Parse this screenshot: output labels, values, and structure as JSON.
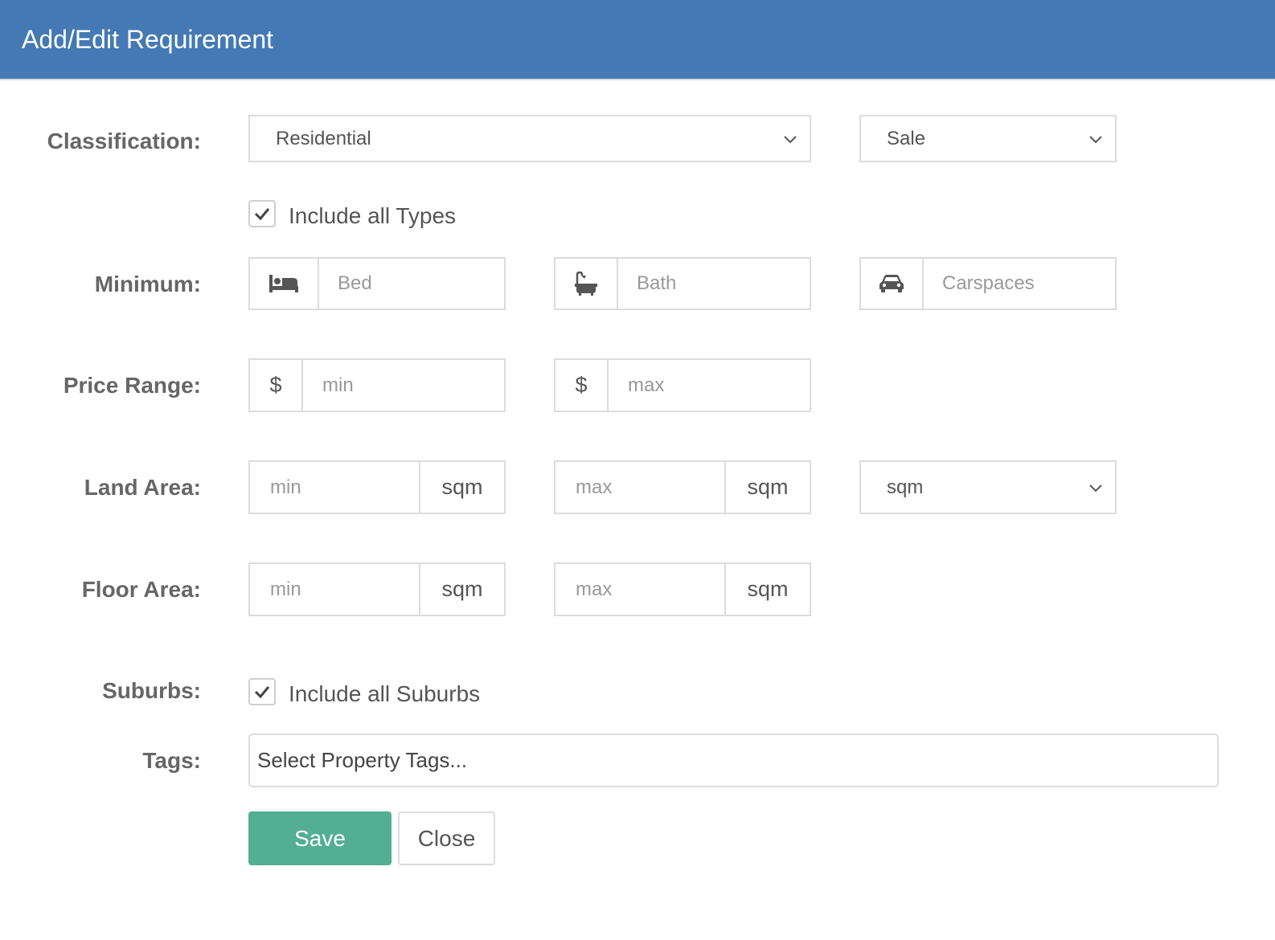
{
  "header": {
    "title": "Add/Edit Requirement"
  },
  "labels": {
    "classification": "Classification:",
    "minimum": "Minimum:",
    "price_range": "Price Range:",
    "land_area": "Land Area:",
    "floor_area": "Floor Area:",
    "suburbs": "Suburbs:",
    "tags": "Tags:"
  },
  "classification": {
    "type_selected": "Residential",
    "listing_selected": "Sale"
  },
  "include_all_types": {
    "label": "Include all Types",
    "checked": true
  },
  "minimum": {
    "bed_placeholder": "Bed",
    "bath_placeholder": "Bath",
    "carspaces_placeholder": "Carspaces"
  },
  "price_range": {
    "currency": "$",
    "min_placeholder": "min",
    "max_placeholder": "max"
  },
  "land_area": {
    "min_placeholder": "min",
    "max_placeholder": "max",
    "unit": "sqm",
    "unit_selected": "sqm"
  },
  "floor_area": {
    "min_placeholder": "min",
    "max_placeholder": "max",
    "unit": "sqm"
  },
  "include_all_suburbs": {
    "label": "Include all Suburbs",
    "checked": true
  },
  "tags": {
    "placeholder": "Select Property Tags..."
  },
  "buttons": {
    "save": "Save",
    "close": "Close"
  },
  "colors": {
    "header": "#4479b4",
    "save": "#52af91",
    "border": "#dcdcdc"
  },
  "icons": [
    "bed-icon",
    "bath-icon",
    "car-icon",
    "check-icon",
    "chevron-down-icon"
  ]
}
